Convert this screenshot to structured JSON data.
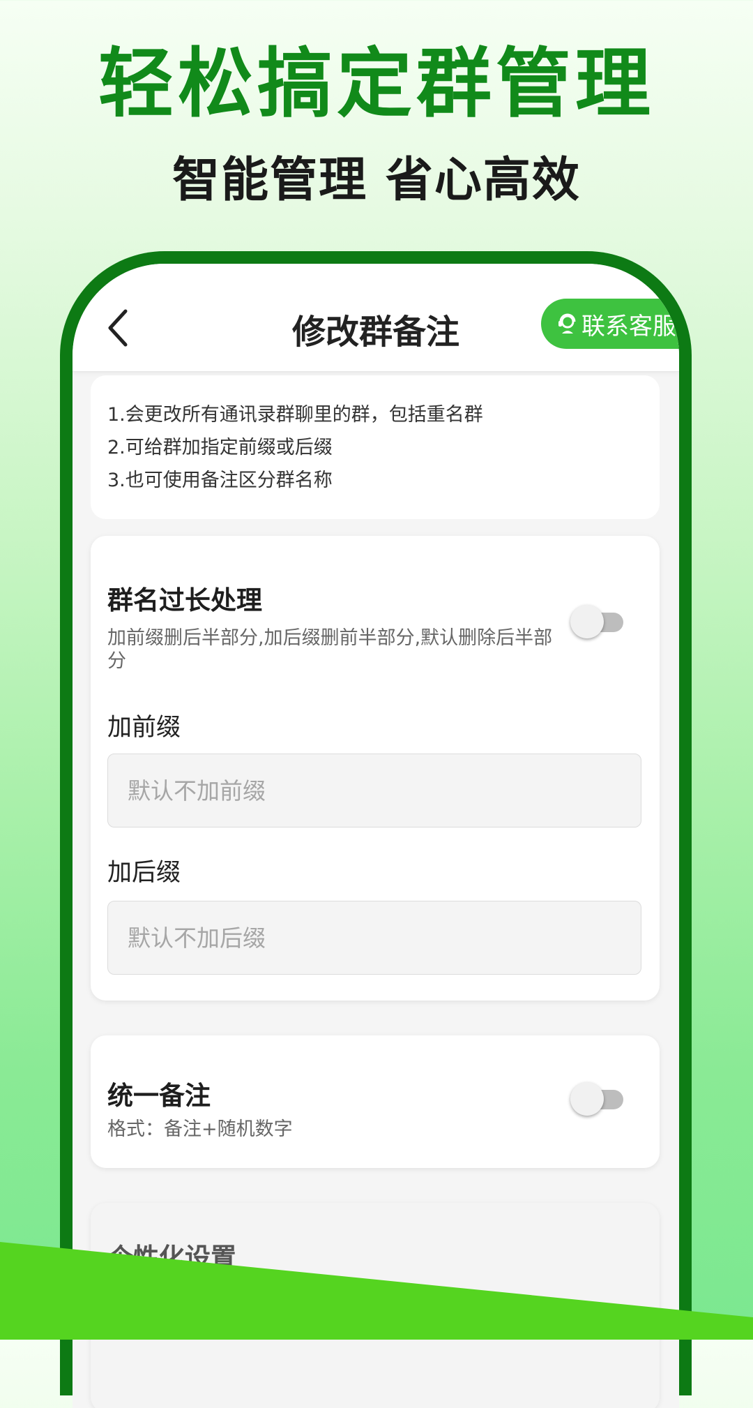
{
  "promo": {
    "headline": "轻松搞定群管理",
    "subheadline": "智能管理 省心高效"
  },
  "navbar": {
    "title": "修改群备注",
    "back_icon": "chevron-left-icon",
    "contact_label": "联系客服",
    "contact_icon": "customer-service-icon"
  },
  "info": {
    "lines": [
      "1.会更改所有通讯录群聊里的群，包括重名群",
      "2.可给群加指定前缀或后缀",
      "3.也可使用备注区分群名称"
    ]
  },
  "long_name": {
    "title": "群名过长处理",
    "description": "加前缀删后半部分,加后缀删前半部分,默认删除后半部分",
    "toggle_on": false,
    "prefix_label": "加前缀",
    "prefix_placeholder": "默认不加前缀",
    "suffix_label": "加后缀",
    "suffix_placeholder": "默认不加后缀"
  },
  "unified_remark": {
    "title": "统一备注",
    "description": "格式：备注+随机数字",
    "toggle_on": false
  },
  "personalize": {
    "title": "个性化设置"
  },
  "colors": {
    "brand_green": "#118a1a",
    "frame_green": "#0d7a14",
    "button_green": "#3ec240",
    "wedge_green": "#55d420"
  }
}
